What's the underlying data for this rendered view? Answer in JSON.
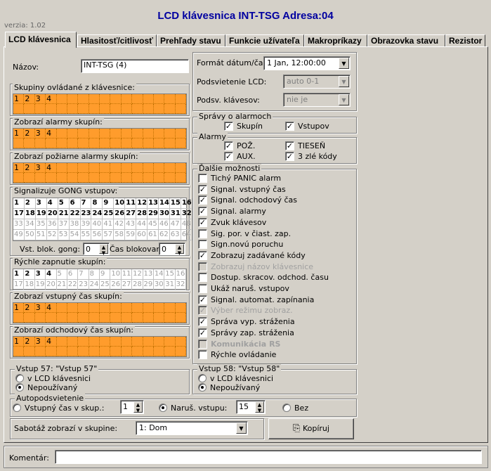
{
  "window": {
    "title": "LCD klávesnica INT-TSG Adresa:04",
    "version": "verzia: 1.02"
  },
  "tabs": [
    "LCD klávesnica",
    "Hlasitosť/citlivosť",
    "Prehľady stavu",
    "Funkcie užívateľa",
    "Makropríkazy",
    "Obrazovka stavu",
    "Rezistor"
  ],
  "name": {
    "label": "Názov:",
    "value": "INT-TSG     (4)"
  },
  "groups": {
    "controlled": {
      "label": "Skupiny ovládané z klávesnice:",
      "cells": [
        "1",
        "2",
        "3",
        "4"
      ]
    },
    "alarms": {
      "label": "Zobrazí alarmy skupín:",
      "cells": [
        "1",
        "2",
        "3",
        "4"
      ]
    },
    "fire": {
      "label": "Zobrazí požiarne alarmy skupín:",
      "cells": [
        "1",
        "2",
        "3",
        "4"
      ]
    },
    "entry": {
      "label": "Zobrazí vstupný čas skupín:",
      "cells": [
        "1",
        "2",
        "3",
        "4"
      ]
    },
    "exit": {
      "label": "Zobrazí odchodový čas skupín:",
      "cells": [
        "1",
        "2",
        "3",
        "4"
      ]
    }
  },
  "gong": {
    "label": "Signalizuje GONG vstupov:",
    "rows": [
      [
        "1",
        "2",
        "3",
        "4",
        "5",
        "6",
        "7",
        "8",
        "9",
        "10",
        "11",
        "12",
        "13",
        "14",
        "15",
        "16"
      ],
      [
        "17",
        "18",
        "19",
        "20",
        "21",
        "22",
        "23",
        "24",
        "25",
        "26",
        "27",
        "28",
        "29",
        "30",
        "31",
        "32"
      ],
      [
        "33",
        "34",
        "35",
        "36",
        "37",
        "38",
        "39",
        "40",
        "41",
        "42",
        "43",
        "44",
        "45",
        "46",
        "47",
        "48"
      ],
      [
        "49",
        "50",
        "51",
        "52",
        "53",
        "54",
        "55",
        "56",
        "57",
        "58",
        "59",
        "60",
        "61",
        "62",
        "63",
        "64"
      ]
    ],
    "block_label": "Vst. blok. gong:",
    "block_value": "0",
    "time_label": "Čas blokovania:",
    "time_value": "0"
  },
  "quick": {
    "label": "Rýchle zapnutie skupín:",
    "rows": [
      [
        "1",
        "2",
        "3",
        "4",
        "5",
        "6",
        "7",
        "8",
        "9",
        "10",
        "11",
        "12",
        "13",
        "14",
        "15",
        "16"
      ],
      [
        "17",
        "18",
        "19",
        "20",
        "21",
        "22",
        "23",
        "24",
        "25",
        "26",
        "27",
        "28",
        "29",
        "30",
        "31",
        "32"
      ]
    ]
  },
  "right": {
    "date_label": "Formát dátum/čas:",
    "date_value": "1 Jan, 12:00:00",
    "lcd_label": "Podsvietenie LCD:",
    "lcd_value": "auto 0-1",
    "keys_label": "Podsv. klávesov:",
    "keys_value": "nie je"
  },
  "alarm_msgs": {
    "label": "Správy o alarmoch",
    "groups": "Skupín",
    "inputs": "Vstupov"
  },
  "alarms": {
    "label": "Alarmy",
    "fire": "POŽ.",
    "panic": "TIESEŇ",
    "aux": "AUX.",
    "codes": "3 zlé kódy"
  },
  "more": {
    "label": "Ďalšie možnosti",
    "items": [
      {
        "t": "Tichý PANIC alarm",
        "c": false,
        "d": false
      },
      {
        "t": "Signal. vstupný čas",
        "c": true,
        "d": false
      },
      {
        "t": "Signal. odchodový čas",
        "c": true,
        "d": false
      },
      {
        "t": "Signal. alarmy",
        "c": true,
        "d": false
      },
      {
        "t": "Zvuk klávesov",
        "c": true,
        "d": false
      },
      {
        "t": "Sig. por. v čiast. zap.",
        "c": false,
        "d": false
      },
      {
        "t": "Sign.novú poruchu",
        "c": false,
        "d": false
      },
      {
        "t": "Zobrazuj zadávané kódy",
        "c": true,
        "d": false
      },
      {
        "t": "Zobrazuj názov klávesnice",
        "c": false,
        "d": true
      },
      {
        "t": "Dostup. skracov. odchod. času",
        "c": false,
        "d": false
      },
      {
        "t": "Ukáž naruš. vstupov",
        "c": false,
        "d": false
      },
      {
        "t": "Signal. automat. zapínania",
        "c": true,
        "d": false
      },
      {
        "t": "Výber režimu zobraz.",
        "c": true,
        "d": true
      },
      {
        "t": "Správa vyp. stráženia",
        "c": true,
        "d": false
      },
      {
        "t": "Správy zap. stráženia",
        "c": true,
        "d": false
      },
      {
        "t": "Komunikácia RS",
        "c": false,
        "d": true
      },
      {
        "t": "Rýchle ovládanie",
        "c": false,
        "d": false
      }
    ]
  },
  "in57": {
    "label": "Vstup 57: \"Vstup  57\"",
    "opt1": "v LCD klávesnici",
    "opt2": "Nepoužívaný"
  },
  "in58": {
    "label": "Vstup 58: \"Vstup  58\"",
    "opt1": "v LCD klávesnici",
    "opt2": "Nepoužívaný"
  },
  "auto": {
    "label": "Autopodsvietenie",
    "opt1": "Vstupný čas v skup.:",
    "val1": "1",
    "opt2": "Naruš. vstupu:",
    "val2": "15",
    "opt3": "Bez"
  },
  "sabotage": {
    "label": "Sabotáž zobrazí v skupine:",
    "value": "1: Dom"
  },
  "copy_btn": "Kopíruj",
  "comment_label": "Komentár:"
}
